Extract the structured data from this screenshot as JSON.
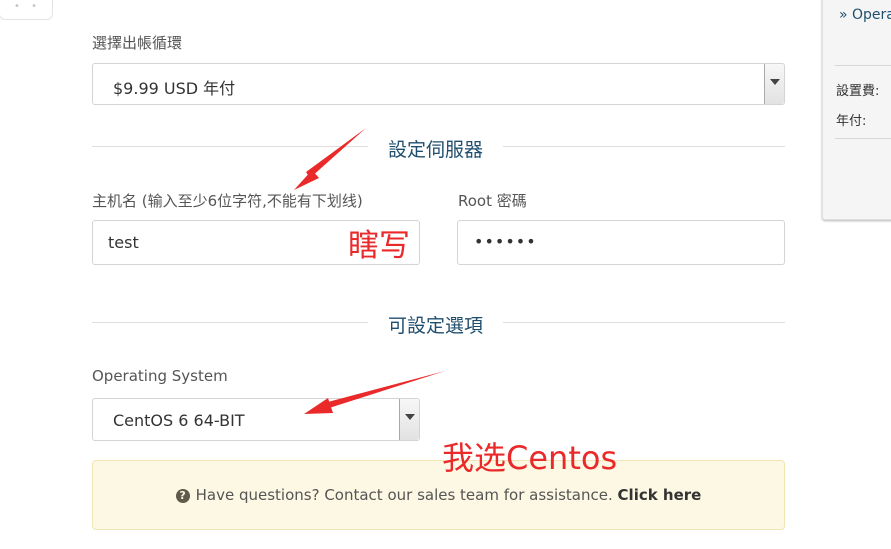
{
  "billing": {
    "label": "選擇出帳循環",
    "selected": "$9.99 USD 年付"
  },
  "server_section": {
    "title": "設定伺服器",
    "hostname_label": "主机名 (输入至少6位字符,不能有下划线)",
    "hostname_value": "test",
    "root_label": "Root 密碼",
    "root_value": "••••••"
  },
  "options_section": {
    "title": "可設定選項",
    "os_label": "Operating System",
    "os_selected": "CentOS 6 64-BIT"
  },
  "notice": {
    "text": "Have questions? Contact our sales team for assistance.",
    "link": "Click here"
  },
  "annotations": {
    "hostname_note": "瞎写",
    "os_note": "我选Centos",
    "color": "#ea2a2a"
  },
  "order_summary": {
    "link": "» Opera",
    "setup_fee_label": "設置費:",
    "annual_label": "年付:"
  },
  "colors": {
    "section_title": "#1f4e6e",
    "notice_bg": "#fcf8e3"
  },
  "icons": [
    "question-circle-icon",
    "chevron-down-icon",
    "drag-handle-icon"
  ]
}
